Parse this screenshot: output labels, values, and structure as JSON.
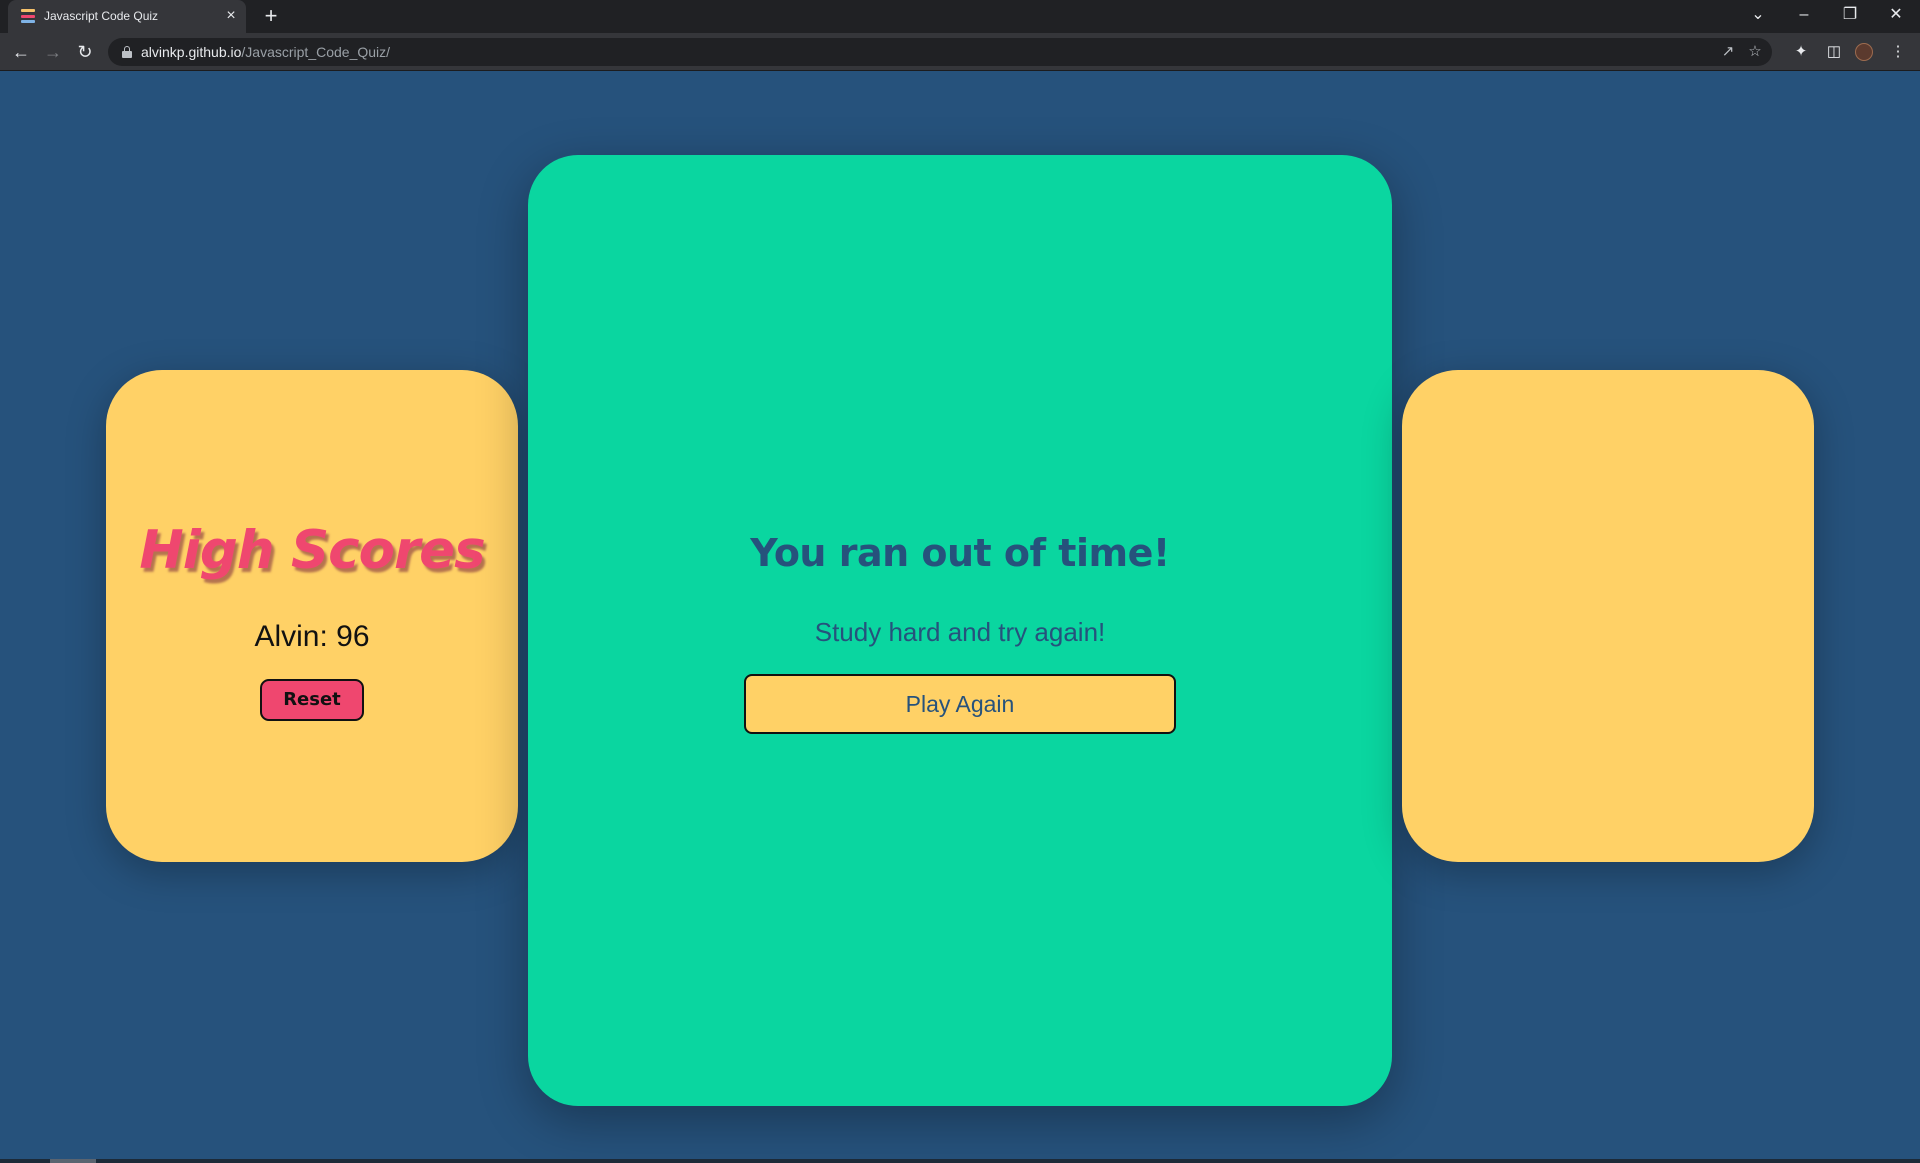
{
  "browser": {
    "tab_title": "Javascript Code Quiz",
    "tab_close_icon": "×",
    "new_tab_icon": "+",
    "url_host": "alvinkp.github.io",
    "url_path": "/Javascript_Code_Quiz/"
  },
  "high_scores": {
    "title": "High Scores",
    "entries": [
      "Alvin: 96"
    ],
    "reset_label": "Reset"
  },
  "main": {
    "title": "You ran out of time!",
    "subtitle": "Study hard and try again!",
    "play_again_label": "Play Again"
  },
  "colors": {
    "background": "#26527c",
    "side_card": "#ffd166",
    "center_card": "#0ad6a0",
    "accent_pink": "#ef476f"
  }
}
